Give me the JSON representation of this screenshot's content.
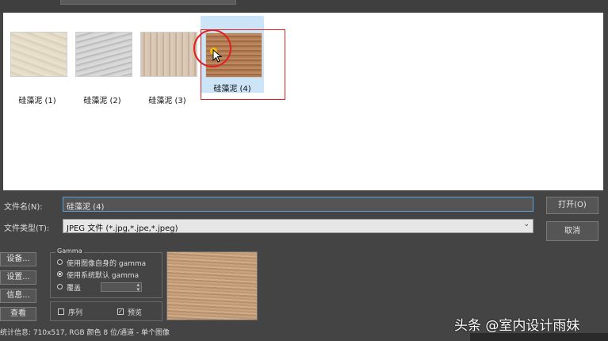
{
  "dialog": {
    "thumbnails": [
      {
        "caption": "硅藻泥 (1)",
        "selected": false
      },
      {
        "caption": "硅藻泥 (2)",
        "selected": false
      },
      {
        "caption": "硅藻泥 (3)",
        "selected": false
      },
      {
        "caption": "硅藻泥 (4)",
        "selected": true
      }
    ],
    "file_name_label": "文件名(N):",
    "file_name_value": "硅藻泥 (4)",
    "file_type_label": "文件类型(T):",
    "file_type_value": "JPEG 文件 (*.jpg,*.jpe,*.jpeg)",
    "open_button": "打开(O)",
    "cancel_button": "取消",
    "side_buttons": [
      "设备...",
      "设置...",
      "信息...",
      "查看"
    ],
    "gamma": {
      "title": "Gamma",
      "option_own": "使用图像自身的 gamma",
      "option_system": "使用系统默认 gamma",
      "option_override": "覆盖",
      "selected": "option_system"
    },
    "sequence_label": "序列",
    "preview_label": "预览",
    "sequence_checked": false,
    "preview_checked": true,
    "stats": "统计信息: 710x517, RGB 颜色 8 位/通道 - 单个图像"
  },
  "overlay": {
    "watermark": "头条 @室内设计雨妹"
  },
  "icons": {
    "cursor": "arrow-cursor-icon",
    "dropdown": "chevron-down-icon",
    "spinner": "spinner-arrows-icon"
  },
  "colors": {
    "highlight": "#e02020",
    "selection": "#cce4f7",
    "focus_border": "#5aa0d8"
  }
}
